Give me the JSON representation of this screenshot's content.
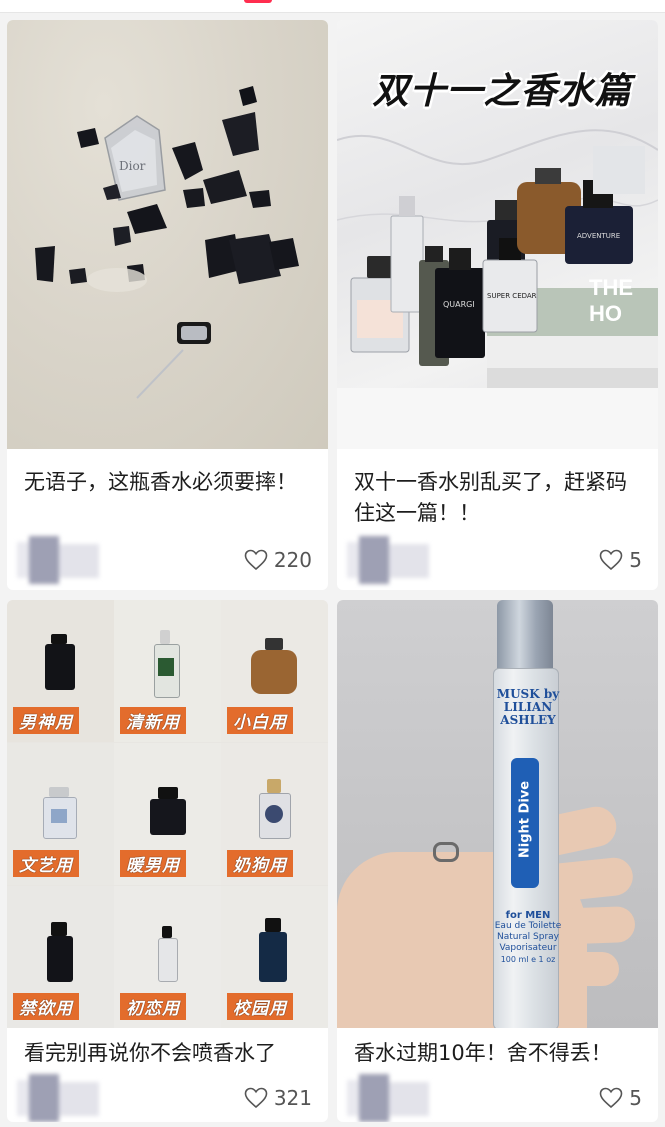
{
  "feed": {
    "cards": [
      {
        "title": "无语子，这瓶香水必须要摔！",
        "likes": "220",
        "image": "broken-perfume-bottle-photo"
      },
      {
        "title": "双十一香水别乱买了，赶紧码住这一篇！！",
        "likes": "5",
        "image": "perfume-collection-photo",
        "overlay_text": "双十一之香水篇",
        "book_text": "THE HO",
        "bottle_labels": [
          "QUARGI",
          "ADVENTURE",
          "SUPER CEDAR"
        ]
      },
      {
        "title": "看完别再说你不会喷香水了",
        "likes": "321",
        "image": "perfume-grid-photo",
        "tags": [
          "男神用",
          "清新用",
          "小白用",
          "文艺用",
          "暖男用",
          "奶狗用",
          "禁欲用",
          "初恋用",
          "校园用"
        ]
      },
      {
        "title": "香水过期10年！舍不得丢！",
        "likes": "5",
        "image": "hand-holding-rollerball-photo",
        "bottle_text": [
          "MUSK by",
          "LILIAN",
          "ASHLEY",
          "Night Dive",
          "for MEN",
          "Eau de Toilette",
          "Natural Spray",
          "Vaporisateur",
          "100 ml e 1 oz"
        ]
      }
    ]
  },
  "colors": {
    "accent": "#ff2d4f",
    "tag_orange": "#e36c2c",
    "text": "#1d1d1d",
    "muted": "#555555"
  },
  "icons": {
    "like": "heart-outline-icon"
  }
}
